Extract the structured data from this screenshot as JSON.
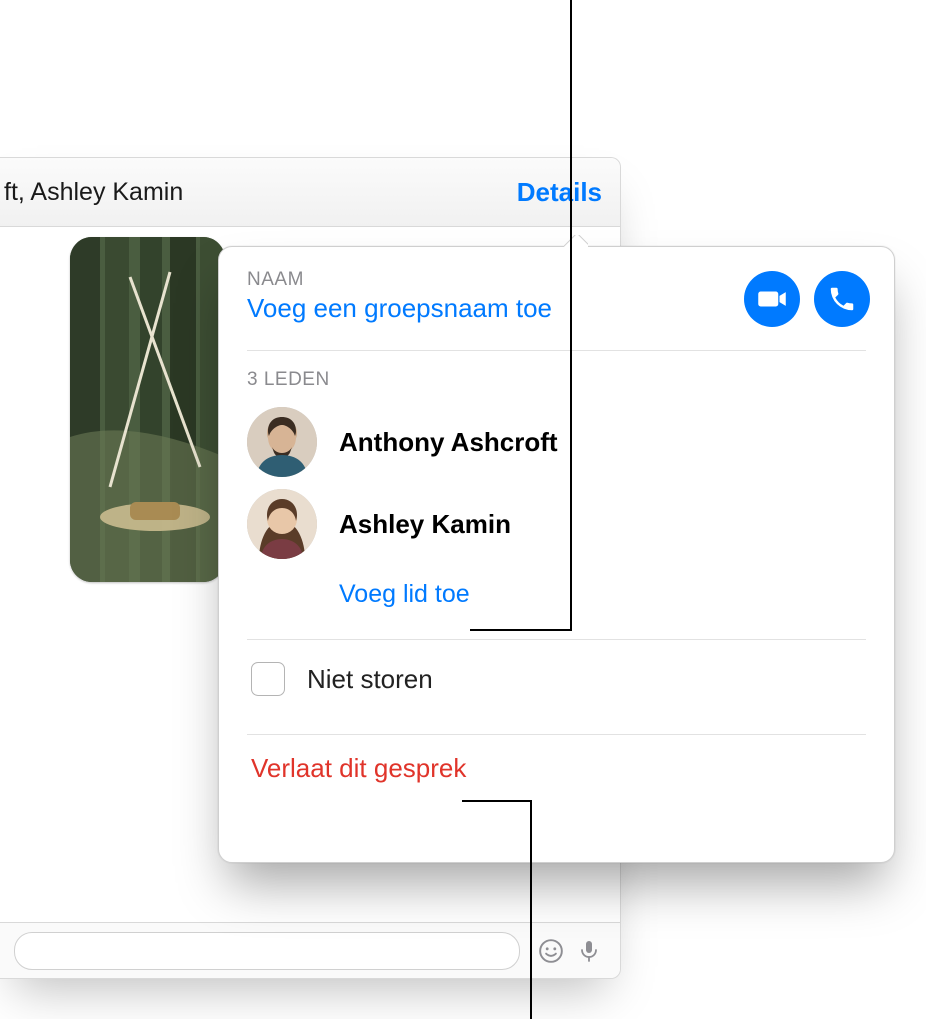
{
  "titlebar": {
    "participants_preview": "ft, Ashley Kamin",
    "details_label": "Details"
  },
  "popover": {
    "name_section_label": "NAAM",
    "add_group_name_label": "Voeg een groepsnaam toe",
    "members_count_label": "3 LEDEN",
    "members": [
      {
        "name": "Anthony Ashcroft"
      },
      {
        "name": "Ashley Kamin"
      }
    ],
    "add_member_label": "Voeg lid toe",
    "dnd_label": "Niet storen",
    "dnd_checked": false,
    "leave_label": "Verlaat dit gesprek"
  },
  "icons": {
    "video": "video-icon",
    "phone": "phone-icon",
    "emoji": "emoji-icon",
    "mic": "mic-icon"
  },
  "colors": {
    "accent_blue": "#007aff",
    "danger_red": "#e0342a",
    "secondary_gray": "#8a8a8e"
  }
}
